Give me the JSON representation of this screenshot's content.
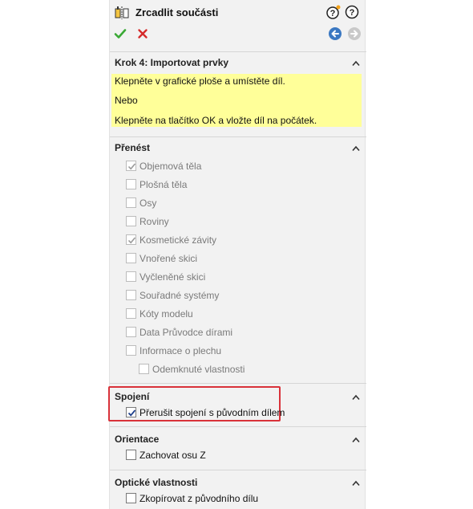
{
  "window": {
    "title": "Zrcadlit součásti"
  },
  "icons": {
    "title": "mirror-components-icon",
    "help1": "help-whats-wrong-icon",
    "help2": "help-icon",
    "ok": "checkmark-icon",
    "cancel": "close-icon",
    "back": "back-arrow-icon",
    "forward": "forward-arrow-icon"
  },
  "colors": {
    "hint_bg": "#ffff99",
    "ok_green": "#3aa935",
    "cancel_red": "#d52b2b",
    "highlight_red": "#d9323a",
    "nav_blue": "#3b78c2"
  },
  "step": {
    "title": "Krok 4: Importovat prvky",
    "lines": [
      "Klepněte v grafické ploše a umístěte díl.",
      "Nebo",
      "Klepněte na tlačítko OK a vložte díl na počátek."
    ]
  },
  "transfer": {
    "title": "Přenést",
    "items": [
      {
        "label": "Objemová těla",
        "checked": true
      },
      {
        "label": "Plošná těla",
        "checked": false
      },
      {
        "label": "Osy",
        "checked": false
      },
      {
        "label": "Roviny",
        "checked": false
      },
      {
        "label": "Kosmetické závity",
        "checked": true
      },
      {
        "label": "Vnořené skici",
        "checked": false
      },
      {
        "label": "Vyčleněné skici",
        "checked": false
      },
      {
        "label": "Souřadné systémy",
        "checked": false
      },
      {
        "label": "Kóty modelu",
        "checked": false
      },
      {
        "label": "Data Průvodce dírami",
        "checked": false
      },
      {
        "label": "Informace o plechu",
        "checked": false
      },
      {
        "label": "Odemknuté vlastnosti",
        "checked": false
      }
    ]
  },
  "link": {
    "title": "Spojení",
    "item": {
      "label": "Přerušit spojení s původním dílem",
      "checked": true
    }
  },
  "orientation": {
    "title": "Orientace",
    "item": {
      "label": "Zachovat osu Z",
      "checked": false
    }
  },
  "optical": {
    "title": "Optické vlastnosti",
    "item": {
      "label": "Zkopírovat z původního dílu",
      "checked": false
    }
  }
}
